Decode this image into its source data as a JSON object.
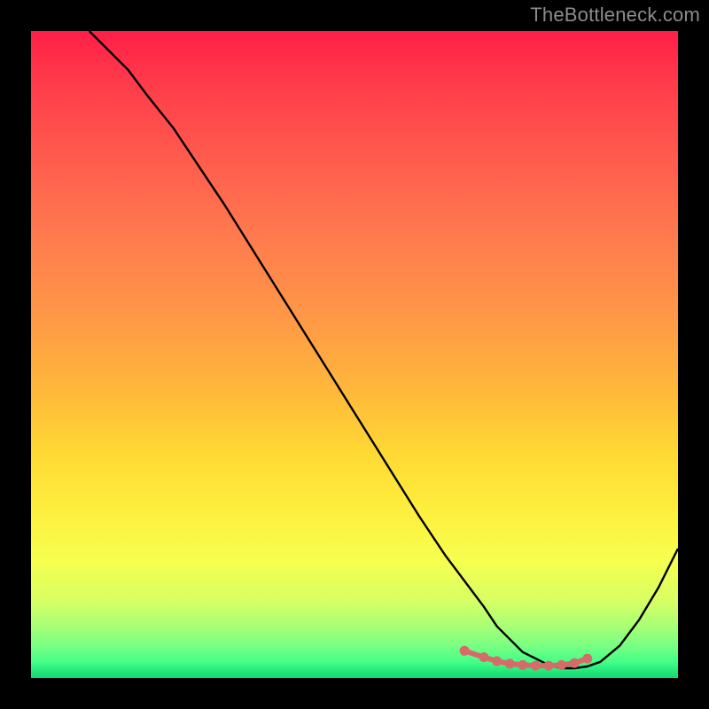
{
  "watermark": "TheBottleneck.com",
  "chart_data": {
    "type": "line",
    "title": "",
    "xlabel": "",
    "ylabel": "",
    "xlim": [
      0,
      100
    ],
    "ylim": [
      0,
      100
    ],
    "series": [
      {
        "name": "curve",
        "x": [
          9,
          12,
          15,
          18,
          22,
          26,
          30,
          35,
          40,
          45,
          50,
          55,
          60,
          64,
          67,
          70,
          72,
          74,
          76,
          78,
          80,
          82,
          84,
          86,
          88,
          91,
          94,
          97,
          100
        ],
        "y": [
          100,
          97,
          94,
          90,
          85,
          79,
          73,
          65,
          57,
          49,
          41,
          33,
          25,
          19,
          15,
          11,
          8,
          6,
          4,
          3,
          2,
          1.5,
          1.5,
          1.8,
          2.5,
          5,
          9,
          14,
          20
        ]
      }
    ],
    "markers": {
      "name": "highlight-points",
      "color": "#d86a6a",
      "x": [
        67,
        70,
        72,
        74,
        76,
        78,
        80,
        82,
        84,
        86
      ],
      "y": [
        4.2,
        3.2,
        2.6,
        2.2,
        2.0,
        1.9,
        1.9,
        2.0,
        2.3,
        3.0
      ]
    }
  },
  "colors": {
    "background": "#000000",
    "curve": "#000000",
    "marker": "#d86a6a",
    "watermark": "#8c8c8c"
  }
}
